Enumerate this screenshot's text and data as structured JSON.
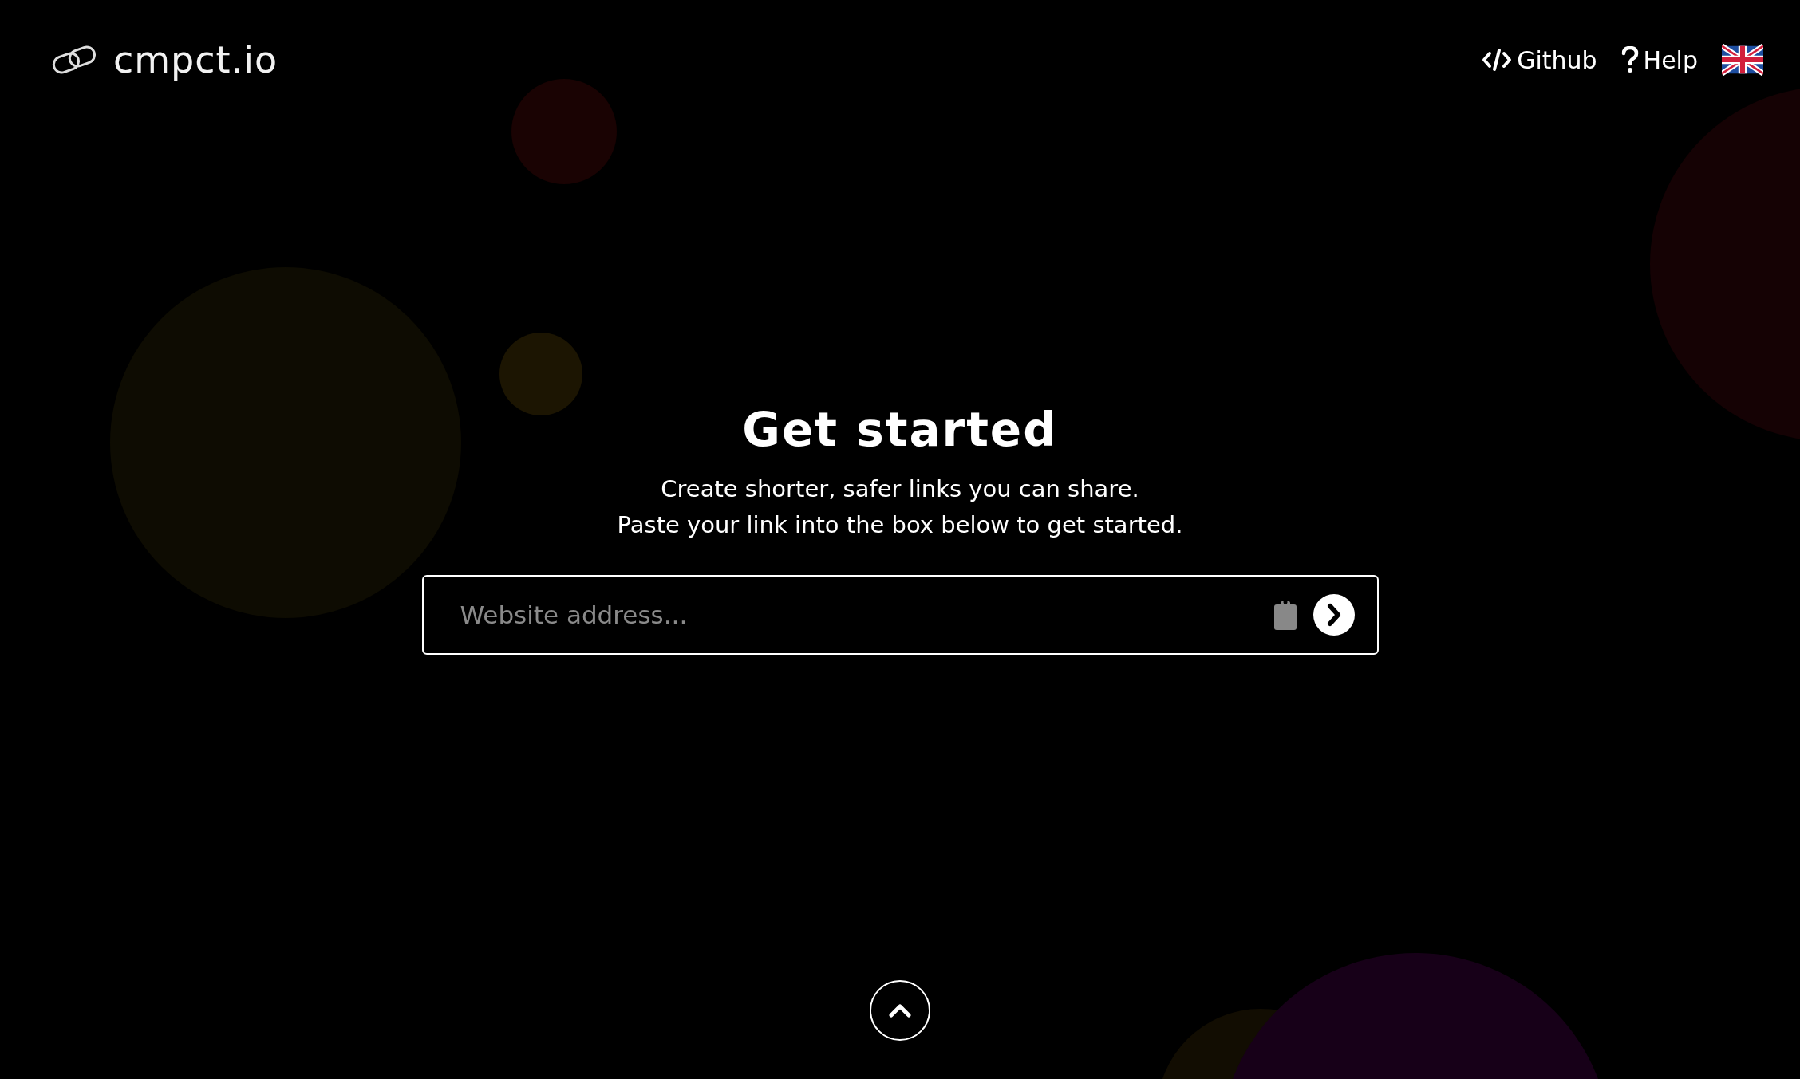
{
  "header": {
    "brand": "cmpct.io",
    "links": [
      {
        "label": "Github",
        "kind": "code"
      },
      {
        "label": "Help",
        "kind": "help"
      }
    ],
    "language_flag": {
      "kind": "uk"
    }
  },
  "hero": {
    "title": "Get started",
    "lines": [
      "Create shorter, safer links you can share.",
      "Paste your link into the box below to get started."
    ]
  },
  "url_field": {
    "placeholder": "Website address..."
  },
  "scroll_up": {
    "kind": "up"
  }
}
